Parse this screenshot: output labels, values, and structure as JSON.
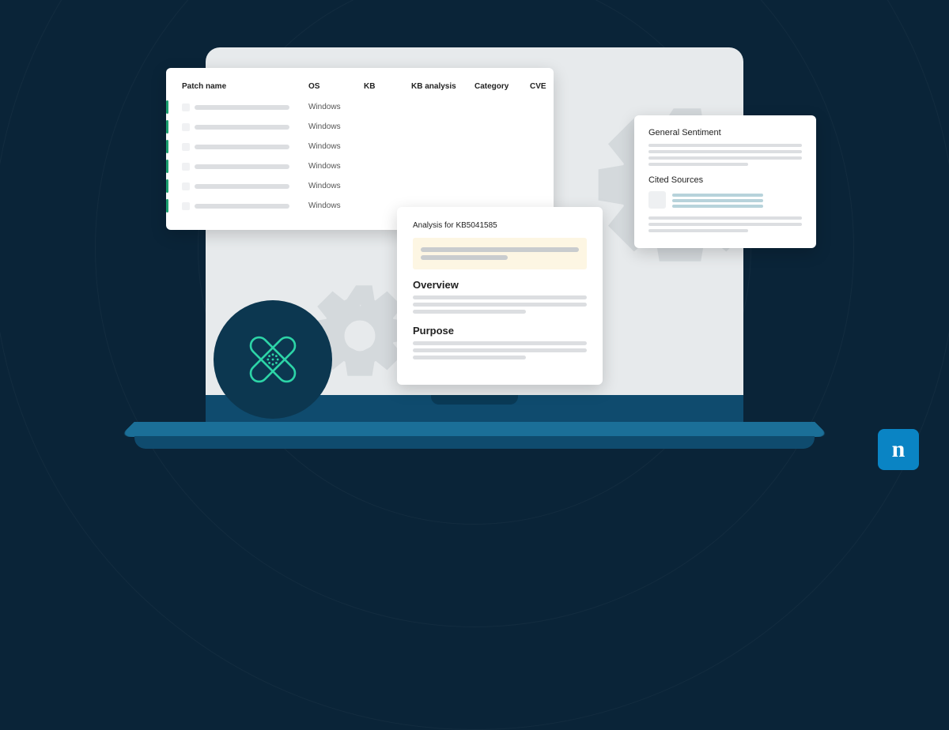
{
  "patch_table": {
    "headers": {
      "name": "Patch name",
      "os": "OS",
      "kb": "KB",
      "kb_analysis": "KB analysis",
      "category": "Category",
      "cve": "CVE"
    },
    "os_value": "Windows"
  },
  "analysis": {
    "title": "Analysis for KB5041585",
    "overview_heading": "Overview",
    "purpose_heading": "Purpose"
  },
  "sentiment": {
    "general_heading": "General Sentiment",
    "cited_heading": "Cited Sources"
  },
  "logo_letter": "n"
}
